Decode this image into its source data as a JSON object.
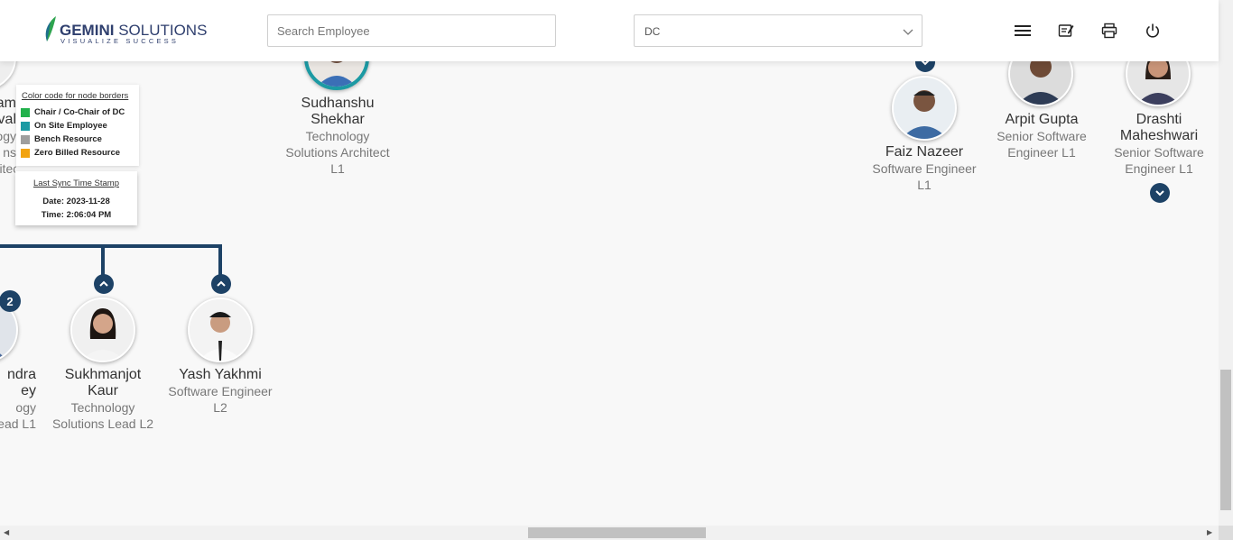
{
  "header": {
    "logo_brand_bold": "GEMINI",
    "logo_brand_light": "SOLUTIONS",
    "logo_tagline": "VISUALIZE SUCCESS",
    "search_placeholder": "Search Employee",
    "dc_select_value": "DC"
  },
  "legend": {
    "title": "Color code for node borders",
    "items": [
      {
        "label": "Chair / Co-Chair of DC",
        "color": "#22b14c"
      },
      {
        "label": "On Site Employee",
        "color": "#1c9aa3"
      },
      {
        "label": "Bench Resource",
        "color": "#9e9e9e"
      },
      {
        "label": "Zero Billed Resource",
        "color": "#f2a30f"
      }
    ]
  },
  "sync": {
    "title": "Last Sync Time Stamp",
    "date": "Date: 2023-11-28",
    "time": "Time: 2:06:04 PM"
  },
  "nodes": {
    "partial_top_left": {
      "name_1": "am",
      "name_2": "val",
      "d1": "ogy",
      "d2": "ns",
      "d3": "rchitect"
    },
    "sudhanshu": {
      "name_1": "Sudhanshu",
      "name_2": "Shekhar",
      "d1": "Technology",
      "d2": "Solutions Architect",
      "d3": "L1"
    },
    "faiz": {
      "name": "Faiz Nazeer",
      "d1": "Software Engineer",
      "d2": "L1"
    },
    "arpit": {
      "name": "Arpit Gupta",
      "d1": "Senior Software",
      "d2": "Engineer L1"
    },
    "drashti": {
      "name_1": "Drashti",
      "name_2": "Maheshwari",
      "d1": "Senior Software",
      "d2": "Engineer L1"
    },
    "partial_bottom_left": {
      "name_1": "ndra",
      "name_2": "ey",
      "d1": "ogy",
      "d2": "ead L1",
      "badge": "2"
    },
    "sukhmanjot": {
      "name_1": "Sukhmanjot",
      "name_2": "Kaur",
      "d1": "Technology",
      "d2": "Solutions Lead L2"
    },
    "yash": {
      "name": "Yash Yakhmi",
      "d1": "Software Engineer",
      "d2": "L2"
    }
  }
}
